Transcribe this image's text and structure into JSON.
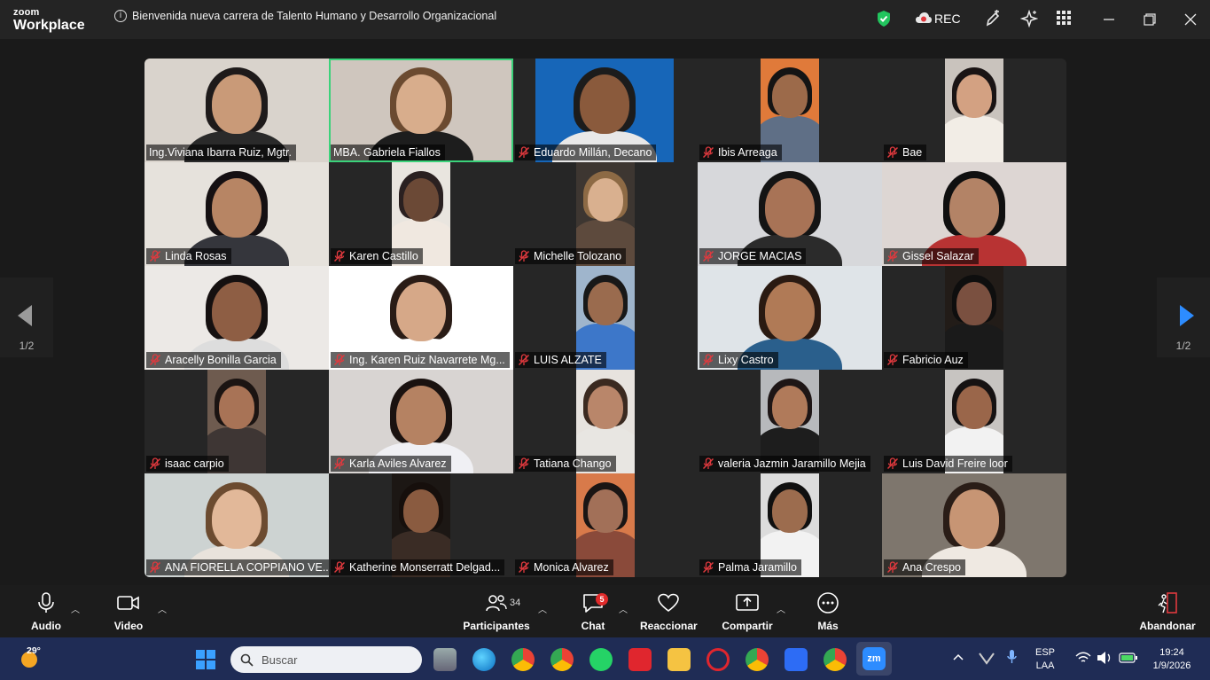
{
  "titlebar": {
    "logo_top": "zoom",
    "logo_bottom": "Workplace",
    "meeting_title": "Bienvenida nueva carrera de Talento Humano y Desarrollo Organizacional",
    "rec_label": "REC"
  },
  "participants": [
    {
      "name": "Ing.Viviana Ibarra Ruiz, Mgtr.",
      "muted": false,
      "active": false
    },
    {
      "name": "MBA. Gabriela Fiallos",
      "muted": false,
      "active": true
    },
    {
      "name": "Eduardo Millán, Decano",
      "muted": true,
      "active": false
    },
    {
      "name": "Ibis Arreaga",
      "muted": true,
      "active": false
    },
    {
      "name": "Bae",
      "muted": true,
      "active": false
    },
    {
      "name": "Linda Rosas",
      "muted": true,
      "active": false
    },
    {
      "name": "Karen Castillo",
      "muted": true,
      "active": false
    },
    {
      "name": "Michelle Tolozano",
      "muted": true,
      "active": false
    },
    {
      "name": "JORGE MACIAS",
      "muted": true,
      "active": false
    },
    {
      "name": "Gissel Salazar",
      "muted": true,
      "active": false
    },
    {
      "name": "Aracelly Bonilla Garcia",
      "muted": true,
      "active": false
    },
    {
      "name": "Ing. Karen Ruiz Navarrete Mg...",
      "muted": true,
      "active": false
    },
    {
      "name": "LUIS ALZATE",
      "muted": true,
      "active": false
    },
    {
      "name": "Lixy Castro",
      "muted": true,
      "active": false
    },
    {
      "name": "Fabricio Auz",
      "muted": true,
      "active": false
    },
    {
      "name": "isaac carpio",
      "muted": true,
      "active": false
    },
    {
      "name": "Karla Aviles Alvarez",
      "muted": true,
      "active": false
    },
    {
      "name": "Tatiana Chango",
      "muted": true,
      "active": false
    },
    {
      "name": "valeria Jazmin Jaramillo Mejia",
      "muted": true,
      "active": false
    },
    {
      "name": "Luis David Freire loor",
      "muted": true,
      "active": false
    },
    {
      "name": "ANA FIORELLA COPPIANO VE...",
      "muted": true,
      "active": false
    },
    {
      "name": "Katherine Monserratt Delgad...",
      "muted": true,
      "active": false
    },
    {
      "name": "Monica Alvarez",
      "muted": true,
      "active": false
    },
    {
      "name": "Palma Jaramillo",
      "muted": true,
      "active": false
    },
    {
      "name": "Ana Crespo",
      "muted": true,
      "active": false
    }
  ],
  "pager": {
    "left": "1/2",
    "right": "1/2"
  },
  "toolbar": {
    "audio": "Audio",
    "video": "Video",
    "participants": "Participantes",
    "participants_count": "34",
    "chat": "Chat",
    "chat_badge": "5",
    "react": "Reaccionar",
    "share": "Compartir",
    "more": "Más",
    "leave": "Abandonar"
  },
  "taskbar": {
    "temperature": "29°",
    "search_placeholder": "Buscar",
    "lang_top": "ESP",
    "lang_bottom": "LAA",
    "time": "19:24",
    "date": "1/9/2026"
  },
  "colors": {
    "active_border": "#3bd27a",
    "mute_red": "#e0393e",
    "taskbar": "#1f2c55",
    "shield_green": "#22c55e",
    "badge_red": "#e02a2a"
  }
}
